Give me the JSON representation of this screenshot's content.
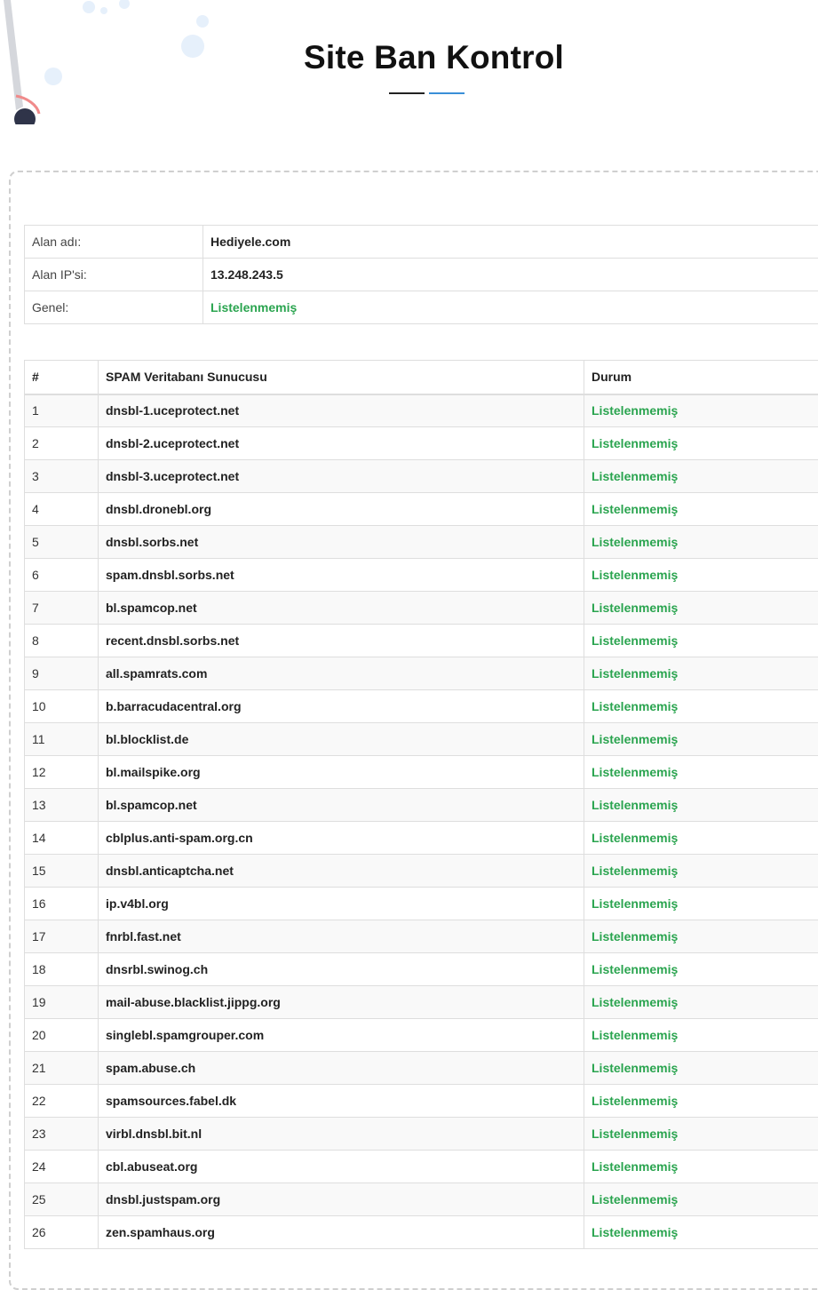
{
  "page": {
    "title": "Site Ban Kontrol"
  },
  "info": [
    {
      "label": "Alan adı:",
      "value": "Hediyele.com",
      "status": false
    },
    {
      "label": "Alan IP'si:",
      "value": "13.248.243.5",
      "status": false
    },
    {
      "label": "Genel:",
      "value": "Listelenmemiş",
      "status": true
    }
  ],
  "table": {
    "headers": {
      "num": "#",
      "server": "SPAM Veritabanı Sunucusu",
      "status": "Durum"
    },
    "rows": [
      {
        "num": "1",
        "server": "dnsbl-1.uceprotect.net",
        "status": "Listelenmemiş"
      },
      {
        "num": "2",
        "server": "dnsbl-2.uceprotect.net",
        "status": "Listelenmemiş"
      },
      {
        "num": "3",
        "server": "dnsbl-3.uceprotect.net",
        "status": "Listelenmemiş"
      },
      {
        "num": "4",
        "server": "dnsbl.dronebl.org",
        "status": "Listelenmemiş"
      },
      {
        "num": "5",
        "server": "dnsbl.sorbs.net",
        "status": "Listelenmemiş"
      },
      {
        "num": "6",
        "server": "spam.dnsbl.sorbs.net",
        "status": "Listelenmemiş"
      },
      {
        "num": "7",
        "server": "bl.spamcop.net",
        "status": "Listelenmemiş"
      },
      {
        "num": "8",
        "server": "recent.dnsbl.sorbs.net",
        "status": "Listelenmemiş"
      },
      {
        "num": "9",
        "server": "all.spamrats.com",
        "status": "Listelenmemiş"
      },
      {
        "num": "10",
        "server": "b.barracudacentral.org",
        "status": "Listelenmemiş"
      },
      {
        "num": "11",
        "server": "bl.blocklist.de",
        "status": "Listelenmemiş"
      },
      {
        "num": "12",
        "server": "bl.mailspike.org",
        "status": "Listelenmemiş"
      },
      {
        "num": "13",
        "server": "bl.spamcop.net",
        "status": "Listelenmemiş"
      },
      {
        "num": "14",
        "server": "cblplus.anti-spam.org.cn",
        "status": "Listelenmemiş"
      },
      {
        "num": "15",
        "server": "dnsbl.anticaptcha.net",
        "status": "Listelenmemiş"
      },
      {
        "num": "16",
        "server": "ip.v4bl.org",
        "status": "Listelenmemiş"
      },
      {
        "num": "17",
        "server": "fnrbl.fast.net",
        "status": "Listelenmemiş"
      },
      {
        "num": "18",
        "server": "dnsrbl.swinog.ch",
        "status": "Listelenmemiş"
      },
      {
        "num": "19",
        "server": "mail-abuse.blacklist.jippg.org",
        "status": "Listelenmemiş"
      },
      {
        "num": "20",
        "server": "singlebl.spamgrouper.com",
        "status": "Listelenmemiş"
      },
      {
        "num": "21",
        "server": "spam.abuse.ch",
        "status": "Listelenmemiş"
      },
      {
        "num": "22",
        "server": "spamsources.fabel.dk",
        "status": "Listelenmemiş"
      },
      {
        "num": "23",
        "server": "virbl.dnsbl.bit.nl",
        "status": "Listelenmemiş"
      },
      {
        "num": "24",
        "server": "cbl.abuseat.org",
        "status": "Listelenmemiş"
      },
      {
        "num": "25",
        "server": "dnsbl.justspam.org",
        "status": "Listelenmemiş"
      },
      {
        "num": "26",
        "server": "zen.spamhaus.org",
        "status": "Listelenmemiş"
      }
    ]
  },
  "colors": {
    "ok": "#2aa44f",
    "accent": "#3a8fd8"
  }
}
